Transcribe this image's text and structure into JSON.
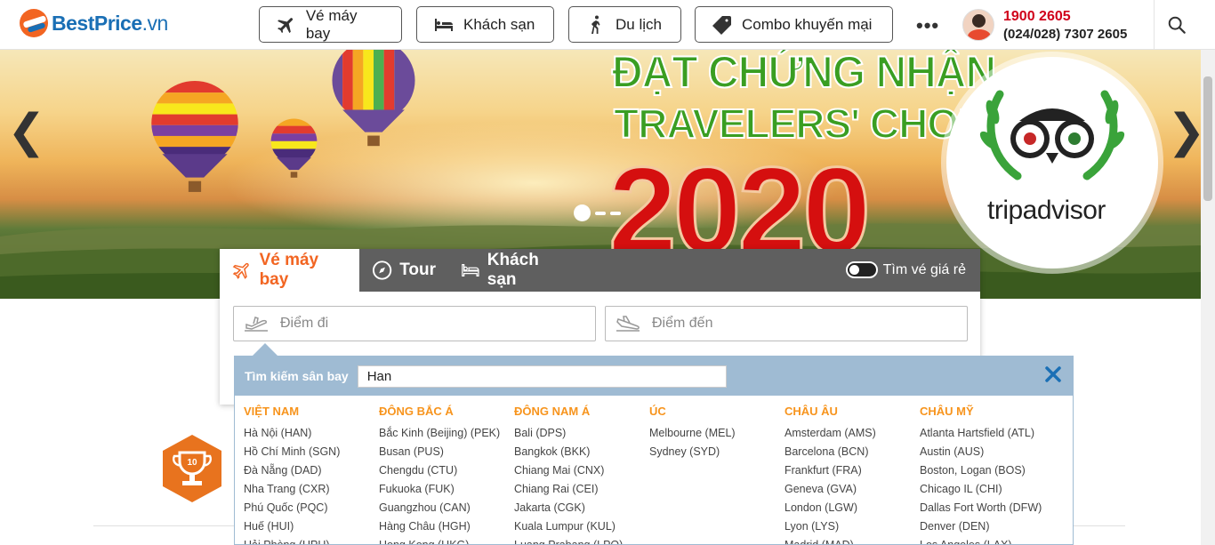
{
  "brand": {
    "name": "BestPrice",
    "tld": ".vn"
  },
  "nav": {
    "items": [
      {
        "label": "Vé máy bay",
        "icon": "plane-icon"
      },
      {
        "label": "Khách sạn",
        "icon": "bed-icon"
      },
      {
        "label": "Du lịch",
        "icon": "hiker-icon"
      },
      {
        "label": "Combo khuyến mại",
        "icon": "tag-icon"
      }
    ],
    "more_label": "•••"
  },
  "contact": {
    "hotline": "1900 2605",
    "phone": "(024/028) 7307 2605"
  },
  "hero": {
    "line1": "ĐẠT CHỨNG NHẬN",
    "line2": "TRAVELERS' CHOICE",
    "year": "2020",
    "partner": "tripadvisor",
    "prev_arrow": "❮",
    "next_arrow": "❯"
  },
  "search": {
    "tabs": [
      {
        "label": "Vé máy bay",
        "active": true,
        "icon": "plane-icon"
      },
      {
        "label": "Tour",
        "active": false,
        "icon": "compass-icon"
      },
      {
        "label": "Khách sạn",
        "active": false,
        "icon": "bed-icon"
      }
    ],
    "cheap_toggle_label": "Tìm vé giá rẻ",
    "from_placeholder": "Điểm đi",
    "to_placeholder": "Điểm đến"
  },
  "airport_search": {
    "label": "Tìm kiếm sân bay",
    "value": "Han",
    "columns": [
      {
        "title": "VIỆT NAM",
        "items": [
          "Hà Nội (HAN)",
          "Hồ Chí Minh (SGN)",
          "Đà Nẵng (DAD)",
          "Nha Trang (CXR)",
          "Phú Quốc (PQC)",
          "Huế (HUI)",
          "Hải Phòng (HPH)"
        ]
      },
      {
        "title": "ĐÔNG BẮC Á",
        "items": [
          "Bắc Kinh (Beijing) (PEK)",
          "Busan (PUS)",
          "Chengdu (CTU)",
          "Fukuoka (FUK)",
          "Guangzhou (CAN)",
          "Hàng Châu (HGH)",
          "Hong Kong (HKG)"
        ]
      },
      {
        "title": "ĐÔNG NAM Á",
        "items": [
          "Bali (DPS)",
          "Bangkok (BKK)",
          "Chiang Mai (CNX)",
          "Chiang Rai (CEI)",
          "Jakarta (CGK)",
          "Kuala Lumpur (KUL)",
          "Luang Prabang (LPQ)"
        ]
      },
      {
        "title": "ÚC",
        "items": [
          "Melbourne (MEL)",
          "Sydney (SYD)"
        ]
      },
      {
        "title": "CHÂU ÂU",
        "items": [
          "Amsterdam (AMS)",
          "Barcelona (BCN)",
          "Frankfurt (FRA)",
          "Geneva (GVA)",
          "London (LGW)",
          "Lyon (LYS)",
          "Madrid (MAD)"
        ]
      },
      {
        "title": "CHÂU MỸ",
        "items": [
          "Atlanta Hartsfield (ATL)",
          "Austin (AUS)",
          "Boston, Logan (BOS)",
          "Chicago IL (CHI)",
          "Dallas Fort Worth (DFW)",
          "Denver (DEN)",
          "Los Angeles (LAX)"
        ]
      }
    ]
  },
  "colors": {
    "brand_blue": "#1a6fb5",
    "brand_orange": "#f26522",
    "hotline_red": "#d0021b",
    "section_orange": "#f7941d",
    "award_green": "#3a9e22",
    "year_red": "#d50f0f"
  }
}
